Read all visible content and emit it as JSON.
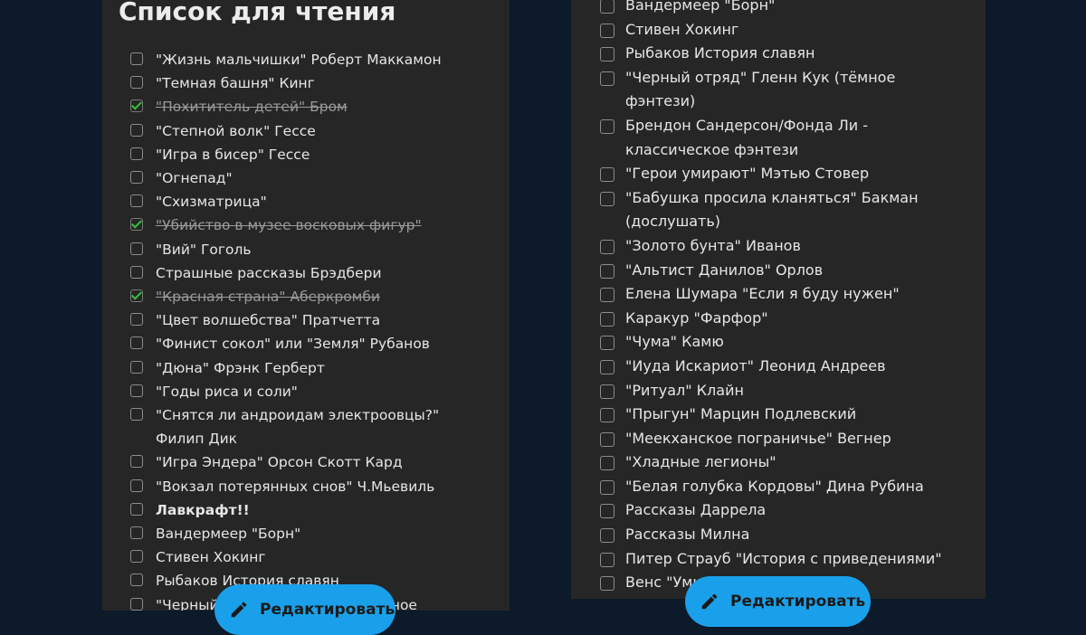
{
  "left": {
    "title": "Список для чтения",
    "items": [
      {
        "text": "\"Жизнь мальчишки\" Роберт Маккамон",
        "checked": false
      },
      {
        "text": "\"Темная башня\" Кинг",
        "checked": false
      },
      {
        "text": "\"Похититель детей\" Бром",
        "checked": true
      },
      {
        "text": "\"Степной волк\" Гессе",
        "checked": false
      },
      {
        "text": "\"Игра в бисер\" Гессе",
        "checked": false
      },
      {
        "text": "\"Огнепад\"",
        "checked": false
      },
      {
        "text": "\"Схизматрица\"",
        "checked": false
      },
      {
        "text": "\"Убийство в музее восковых фигур\"",
        "checked": true
      },
      {
        "text": "\"Вий\" Гоголь",
        "checked": false
      },
      {
        "text": "Страшные рассказы Брэдбери",
        "checked": false
      },
      {
        "text": "\"Красная страна\" Аберкромби",
        "checked": true
      },
      {
        "text": "\"Цвет волшебства\" Пратчетта",
        "checked": false
      },
      {
        "text": "\"Финист сокол\" или \"Земля\" Рубанов",
        "checked": false
      },
      {
        "text": "\"Дюна\" Фрэнк Герберт",
        "checked": false
      },
      {
        "text": "\"Годы риса и соли\"",
        "checked": false
      },
      {
        "text": "\"Снятся ли андроидам электроовцы?\" Филип Дик",
        "checked": false
      },
      {
        "text": "\"Игра Эндера\" Орсон Скотт Кард",
        "checked": false
      },
      {
        "text": "\"Вокзал потерянных снов\" Ч.Мьевиль",
        "checked": false
      },
      {
        "text": "Лавкрафт!!",
        "checked": false,
        "bold": true
      },
      {
        "text": "Вандермеер \"Борн\"",
        "checked": false
      },
      {
        "text": "Стивен Хокинг",
        "checked": false
      },
      {
        "text": "Рыбаков История славян",
        "checked": false
      },
      {
        "text": "\"Черный отряд\" Гленн Кук (тёмное фэнтези)",
        "checked": false
      }
    ],
    "edit_label": "Редактировать"
  },
  "right": {
    "items": [
      {
        "text": "Вандермеер \"Борн\"",
        "checked": false
      },
      {
        "text": "Стивен Хокинг",
        "checked": false
      },
      {
        "text": "Рыбаков История славян",
        "checked": false
      },
      {
        "text": "\"Черный отряд\" Гленн Кук (тёмное фэнтези)",
        "checked": false
      },
      {
        "text": "Брендон Сандерсон/Фонда Ли - классическое фэнтези",
        "checked": false
      },
      {
        "text": "\"Герои умирают\" Мэтью Стовер",
        "checked": false
      },
      {
        "text": "\"Бабушка просила кланяться\" Бакман (дослушать)",
        "checked": false
      },
      {
        "text": "\"Золото бунта\" Иванов",
        "checked": false
      },
      {
        "text": "\"Альтист Данилов\" Орлов",
        "checked": false
      },
      {
        "text": "Елена Шумара \"Если я буду нужен\"",
        "checked": false
      },
      {
        "text": "Каракур \"Фарфор\"",
        "checked": false
      },
      {
        "text": "\"Чума\" Камю",
        "checked": false
      },
      {
        "text": "\"Иуда Искариот\" Леонид Андреев",
        "checked": false
      },
      {
        "text": "\"Ритуал\" Клайн",
        "checked": false
      },
      {
        "text": "\"Прыгун\" Марцин Подлевский",
        "checked": false
      },
      {
        "text": "\"Меекханское пограничье\" Вегнер",
        "checked": false
      },
      {
        "text": "\"Хладные легионы\"",
        "checked": false
      },
      {
        "text": "\"Белая голубка Кордовы\" Дина Рубина",
        "checked": false
      },
      {
        "text": "Рассказы Даррела",
        "checked": false
      },
      {
        "text": "Рассказы Милна",
        "checked": false
      },
      {
        "text": "Питер Страуб \"История с приведениями\"",
        "checked": false
      },
      {
        "text": "Венс \"Умирающая земля\"",
        "checked": false
      }
    ],
    "edit_label": "Редактировать"
  },
  "colors": {
    "background": "#0c1a2a",
    "panel": "#262626",
    "accent": "#1aa0ea",
    "check": "#34c23b"
  },
  "icons": {
    "edit": "pencil-icon",
    "check": "checkmark-icon"
  }
}
